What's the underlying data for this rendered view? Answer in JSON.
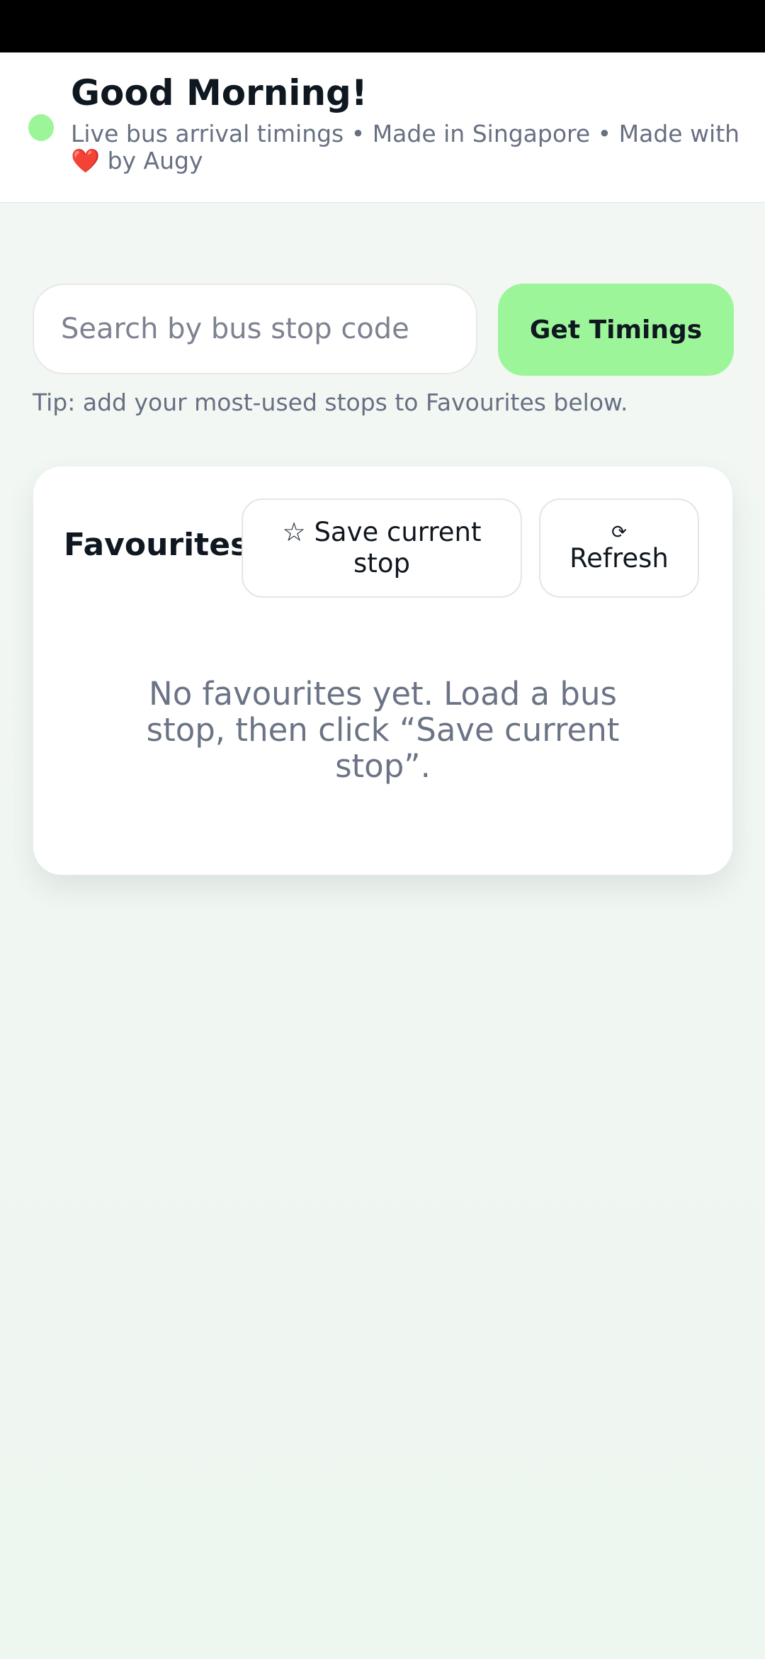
{
  "header": {
    "greeting": "Good Morning!",
    "subtitle_before": "Live bus arrival timings • Made in Singapore • Made with ",
    "heart": "❤️",
    "subtitle_after": " by Augy",
    "status_color": "#9df59a"
  },
  "search": {
    "placeholder": "Search by bus stop code",
    "value": "",
    "button_label": "Get Timings",
    "tip": "Tip: add your most-used stops to Favourites below."
  },
  "favourites": {
    "title": "Favourites",
    "save_icon": "☆",
    "save_label": "Save current stop",
    "refresh_icon": "⟳",
    "refresh_label": "Refresh",
    "empty_message": "No favourites yet. Load a bus stop, then click “Save current stop”."
  },
  "colors": {
    "accent": "#9df59a",
    "heart": "#ef3b5c",
    "muted_text": "#677082"
  }
}
